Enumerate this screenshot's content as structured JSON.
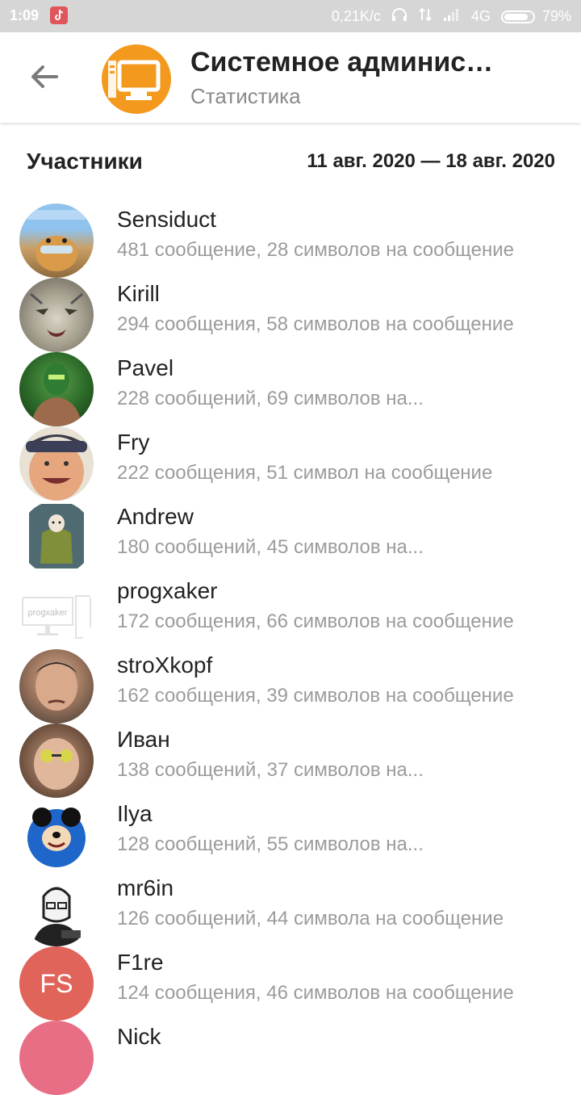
{
  "status": {
    "time": "1:09",
    "speed": "0,21K/c",
    "network": "4G",
    "battery": "79%"
  },
  "header": {
    "title": "Системное админис…",
    "subtitle": "Статистика",
    "avatar_color": "#f39a1e"
  },
  "section": {
    "title": "Участники",
    "range": "11 авг. 2020 — 18 авг. 2020"
  },
  "members": [
    {
      "name": "Sensiduct",
      "stats": "481 сообщение, 28 символов на сообщение"
    },
    {
      "name": "Kirill",
      "stats": "294 сообщения, 58 символов на сообщение"
    },
    {
      "name": "Pavel",
      "stats": "228 сообщений, 69 символов на..."
    },
    {
      "name": "Fry",
      "stats": "222 сообщения, 51 символ на сообщение"
    },
    {
      "name": "Andrew",
      "stats": "180 сообщений, 45 символов на..."
    },
    {
      "name": "progxaker",
      "stats": "172 сообщения, 66 символов на сообщение",
      "avatar_text": "progxaker"
    },
    {
      "name": "stroXkopf",
      "stats": "162 сообщения, 39 символов на сообщение"
    },
    {
      "name": "Иван",
      "stats": "138 сообщений, 37 символов на..."
    },
    {
      "name": "Ilya",
      "stats": "128 сообщений, 55 символов на..."
    },
    {
      "name": "mr6in",
      "stats": "126 сообщений, 44 символа на сообщение"
    },
    {
      "name": "F1re",
      "stats": "124 сообщения, 46 символов на сообщение",
      "initials": "FS",
      "avatar_color": "#e0645a"
    },
    {
      "name": "Nick",
      "stats": "",
      "avatar_color": "#e86e86"
    }
  ]
}
